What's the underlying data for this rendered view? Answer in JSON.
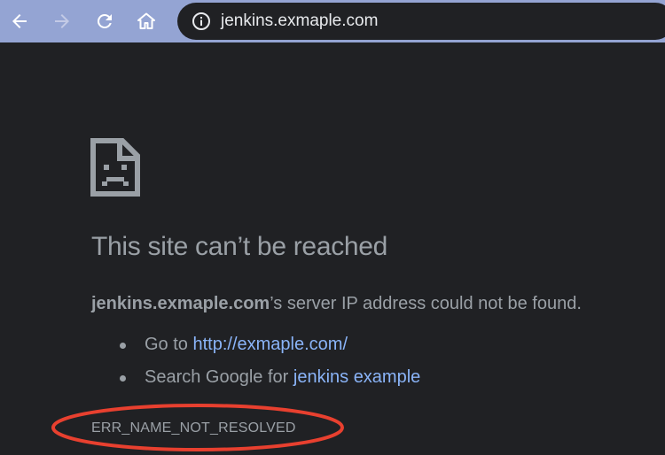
{
  "browser": {
    "url": "jenkins.exmaple.com",
    "icons": {
      "back": "arrow-left-icon",
      "forward": "arrow-right-icon",
      "reload": "reload-icon",
      "home": "home-icon",
      "site_info": "info-icon"
    },
    "toolbar_color": "#94a4d3"
  },
  "error_page": {
    "icon": "sad-page-icon",
    "title": "This site can’t be reached",
    "host": "jenkins.exmaple.com",
    "description_suffix": "’s server IP address could not be found.",
    "suggestions": [
      {
        "prefix": "Go to ",
        "link": "http://exmaple.com/"
      },
      {
        "prefix": "Search Google for ",
        "link": "jenkins example"
      }
    ],
    "error_code": "ERR_NAME_NOT_RESOLVED"
  },
  "annotation": {
    "shape": "ellipse",
    "color": "#e8402f"
  },
  "colors": {
    "page_background": "#202124",
    "text": "#9aa0a6",
    "link": "#8ab4f8"
  }
}
